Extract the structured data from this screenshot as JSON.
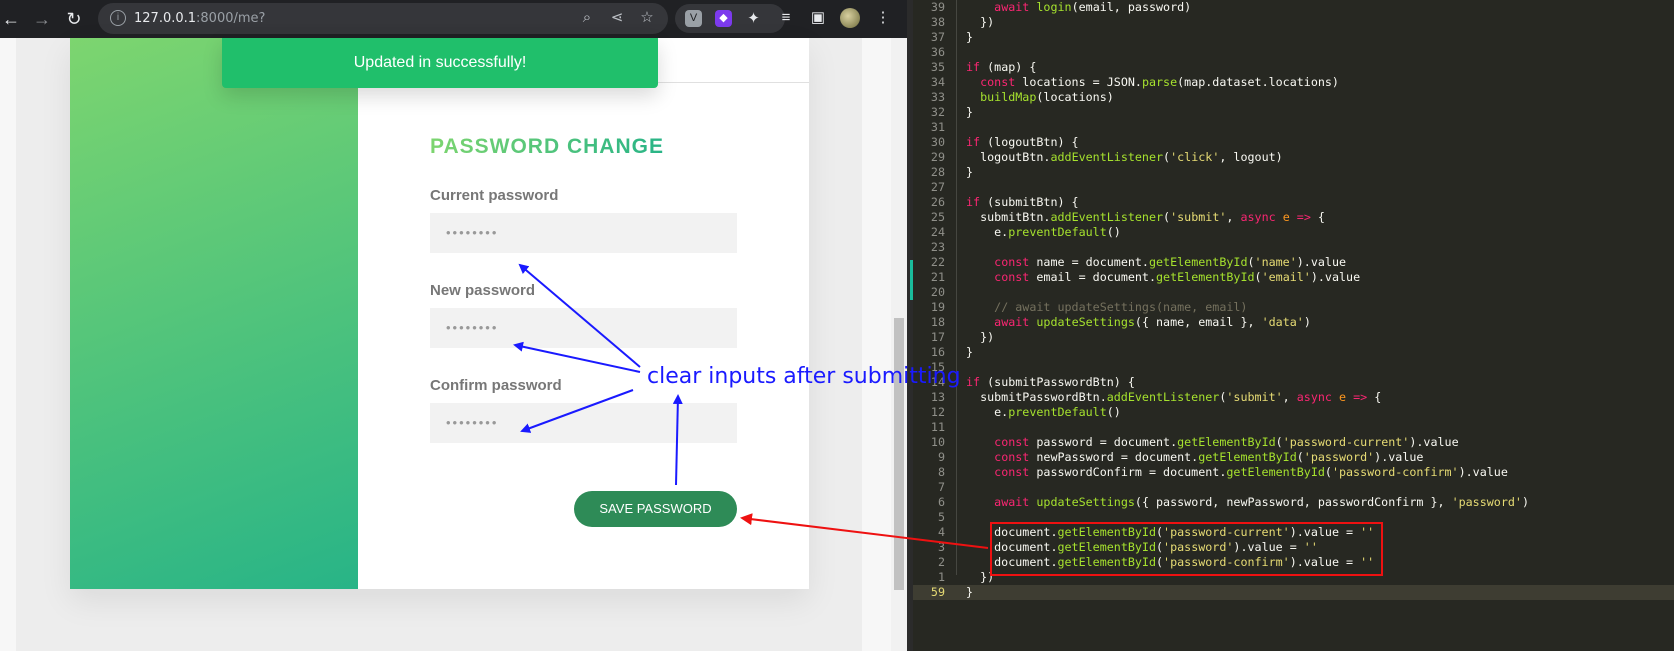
{
  "browser": {
    "url_host": "127.0.0.1",
    "url_path": ":8000/me?",
    "icons": [
      "back-icon",
      "forward-icon",
      "reload-icon",
      "info-icon",
      "zoom-icon",
      "share-icon",
      "star-icon",
      "extension-v-icon",
      "extension-purple-icon",
      "extensions-icon",
      "media-icon",
      "sidepanel-icon",
      "menu-icon"
    ]
  },
  "page": {
    "toast": "Updated in successfully!",
    "title_first": "PASSWORD",
    "title_second": " CHANGE",
    "fields": [
      {
        "label": "Current password",
        "value": "••••••••"
      },
      {
        "label": "New password",
        "value": "••••••••"
      },
      {
        "label": "Confirm password",
        "value": "••••••••"
      }
    ],
    "save_label": "SAVE PASSWORD"
  },
  "annotation": {
    "text": "clear inputs after submitting",
    "colors": {
      "blue": "#1a1aff",
      "red": "#ee1111"
    }
  },
  "editor": {
    "lines": [
      {
        "num": "39",
        "html": "    <span class=\"kw\">await</span> <span class=\"fn\">login</span>(email, password)"
      },
      {
        "num": "38",
        "html": "  })"
      },
      {
        "num": "37",
        "html": "}"
      },
      {
        "num": "36",
        "html": ""
      },
      {
        "num": "35",
        "html": "<span class=\"kw\">if</span> (map) {"
      },
      {
        "num": "34",
        "html": "  <span class=\"kw\">const</span> locations = JSON.<span class=\"fn\">parse</span>(map.dataset.locations)"
      },
      {
        "num": "33",
        "html": "  <span class=\"fn\">buildMap</span>(locations)"
      },
      {
        "num": "32",
        "html": "}"
      },
      {
        "num": "31",
        "html": ""
      },
      {
        "num": "30",
        "html": "<span class=\"kw\">if</span> (logoutBtn) {"
      },
      {
        "num": "29",
        "html": "  logoutBtn.<span class=\"fn\">addEventListener</span>(<span class=\"st\">'click'</span>, logout)"
      },
      {
        "num": "28",
        "html": "}"
      },
      {
        "num": "27",
        "html": ""
      },
      {
        "num": "26",
        "html": "<span class=\"kw\">if</span> (submitBtn) {"
      },
      {
        "num": "25",
        "html": "  submitBtn.<span class=\"fn\">addEventListener</span>(<span class=\"st\">'submit'</span>, <span class=\"kw\">async</span> <span class=\"pa\">e</span> <span class=\"kw\">=&gt;</span> {"
      },
      {
        "num": "24",
        "html": "    e.<span class=\"fn\">preventDefault</span>()"
      },
      {
        "num": "23",
        "html": ""
      },
      {
        "num": "22",
        "html": "    <span class=\"kw\">const</span> name = document.<span class=\"fn\">getElementById</span>(<span class=\"st\">'name'</span>).value"
      },
      {
        "num": "21",
        "html": "    <span class=\"kw\">const</span> email = document.<span class=\"fn\">getElementById</span>(<span class=\"st\">'email'</span>).value"
      },
      {
        "num": "20",
        "html": ""
      },
      {
        "num": "19",
        "html": "    <span class=\"cm\">// await updateSettings(name, email)</span>"
      },
      {
        "num": "18",
        "html": "    <span class=\"kw\">await</span> <span class=\"fn\">updateSettings</span>({ name, email }, <span class=\"st\">'data'</span>)"
      },
      {
        "num": "17",
        "html": "  })"
      },
      {
        "num": "16",
        "html": "}"
      },
      {
        "num": "15",
        "html": ""
      },
      {
        "num": "14",
        "html": "<span class=\"kw\">if</span> (submitPasswordBtn) {"
      },
      {
        "num": "13",
        "html": "  submitPasswordBtn.<span class=\"fn\">addEventListener</span>(<span class=\"st\">'submit'</span>, <span class=\"kw\">async</span> <span class=\"pa\">e</span> <span class=\"kw\">=&gt;</span> {"
      },
      {
        "num": "12",
        "html": "    e.<span class=\"fn\">preventDefault</span>()"
      },
      {
        "num": "11",
        "html": ""
      },
      {
        "num": "10",
        "html": "    <span class=\"kw\">const</span> password = document.<span class=\"fn\">getElementById</span>(<span class=\"st\">'password-current'</span>).value"
      },
      {
        "num": "9",
        "html": "    <span class=\"kw\">const</span> newPassword = document.<span class=\"fn\">getElementById</span>(<span class=\"st\">'password'</span>).value"
      },
      {
        "num": "8",
        "html": "    <span class=\"kw\">const</span> passwordConfirm = document.<span class=\"fn\">getElementById</span>(<span class=\"st\">'password-confirm'</span>).value"
      },
      {
        "num": "7",
        "html": ""
      },
      {
        "num": "6",
        "html": "    <span class=\"kw\">await</span> <span class=\"fn\">updateSettings</span>({ password, newPassword, passwordConfirm }, <span class=\"st\">'password'</span>)"
      },
      {
        "num": "5",
        "html": ""
      },
      {
        "num": "4",
        "html": "    document.<span class=\"fn\">getElementById</span>(<span class=\"st\">'password-current'</span>).value = <span class=\"st\">''</span>"
      },
      {
        "num": "3",
        "html": "    document.<span class=\"fn\">getElementById</span>(<span class=\"st\">'password'</span>).value = <span class=\"st\">''</span>"
      },
      {
        "num": "2",
        "html": "    document.<span class=\"fn\">getElementById</span>(<span class=\"st\">'password-confirm'</span>).value = <span class=\"st\">''</span>"
      },
      {
        "num": "1",
        "html": "  })"
      },
      {
        "num": "59",
        "html": "}",
        "current": true
      }
    ]
  }
}
